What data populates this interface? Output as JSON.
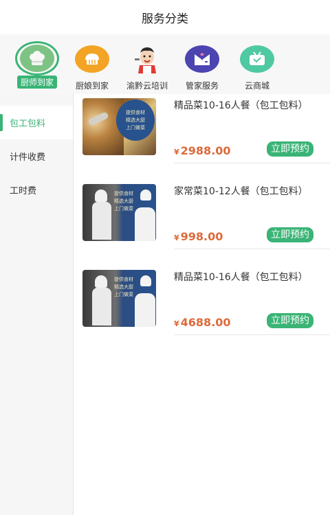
{
  "header": {
    "title": "服务分类"
  },
  "categories": [
    {
      "label": "厨师到家",
      "icon": "chef-hat-icon",
      "active": true
    },
    {
      "label": "厨娘到家",
      "icon": "bread-icon",
      "active": false
    },
    {
      "label": "渝黔云培训",
      "icon": "cook-mascot-icon",
      "active": false
    },
    {
      "label": "管家服务",
      "icon": "butler-suit-icon",
      "active": false
    },
    {
      "label": "云商城",
      "icon": "shop-tv-icon",
      "active": false
    }
  ],
  "sidebar": {
    "items": [
      {
        "label": "包工包料",
        "active": true
      },
      {
        "label": "计件收费",
        "active": false
      },
      {
        "label": "工时费",
        "active": false
      }
    ]
  },
  "products": [
    {
      "name": "精品菜10-16人餐（包工包料）",
      "currency": "¥",
      "price": "2988.00",
      "button": "立即预约",
      "banner": [
        "提供食材",
        "精选大厨",
        "上门做菜"
      ]
    },
    {
      "name": "家常菜10-12人餐（包工包料）",
      "currency": "¥",
      "price": "998.00",
      "button": "立即预约",
      "banner": [
        "提供食材",
        "精选大厨",
        "上门做菜"
      ]
    },
    {
      "name": "精品菜10-16人餐（包工包料）",
      "currency": "¥",
      "price": "4688.00",
      "button": "立即预约",
      "banner": [
        "提供食材",
        "精选大厨",
        "上门做菜"
      ]
    }
  ],
  "colors": {
    "accent": "#3ab476",
    "price": "#dd6a3a"
  }
}
